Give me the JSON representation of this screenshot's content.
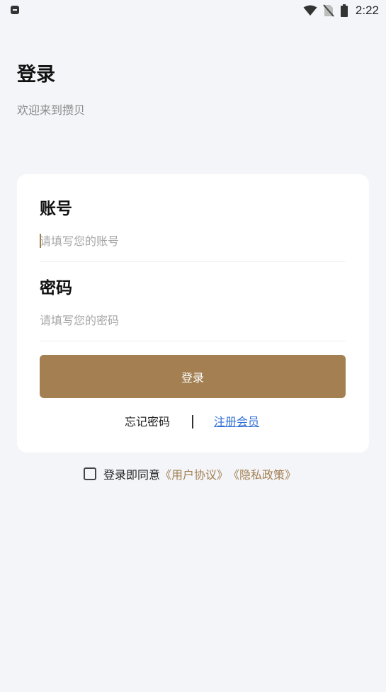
{
  "status_bar": {
    "time": "2:22",
    "icons": [
      "notification-icon",
      "wifi-icon",
      "no-sim-icon",
      "battery-icon"
    ]
  },
  "header": {
    "title": "登录",
    "subtitle": "欢迎来到攒贝"
  },
  "form": {
    "account_label": "账号",
    "account_placeholder": "请填写您的账号",
    "password_label": "密码",
    "password_placeholder": "请填写您的密码",
    "login_button": "登录",
    "forgot_password": "忘记密码",
    "register": "注册会员"
  },
  "agreement": {
    "prefix": "登录即同意",
    "user_agreement": "《用户协议》",
    "privacy_policy": "《隐私政策》"
  },
  "colors": {
    "accent": "#a37f51",
    "link": "#2f6fd6",
    "background": "#f4f5f9"
  }
}
